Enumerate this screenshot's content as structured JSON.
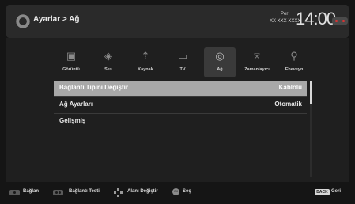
{
  "header": {
    "breadcrumb": "Ayarlar > Ağ",
    "day": "Per",
    "date": "XX XXX XXXX",
    "time": "14:00"
  },
  "tabs": [
    {
      "label": "Görüntü",
      "icon": "picture-icon"
    },
    {
      "label": "Ses",
      "icon": "speaker-icon"
    },
    {
      "label": "Kaynak",
      "icon": "source-icon"
    },
    {
      "label": "TV",
      "icon": "tv-icon"
    },
    {
      "label": "Ağ",
      "icon": "network-globe-icon",
      "active": true
    },
    {
      "label": "Zamanlayıcı",
      "icon": "timer-icon"
    },
    {
      "label": "Ebeveyn",
      "icon": "parental-icon"
    }
  ],
  "menu": [
    {
      "label": "Bağlantı Tipini Değiştir",
      "value": "Kablolu",
      "selected": true
    },
    {
      "label": "Ağ Ayarları",
      "value": "Otomatik"
    },
    {
      "label": "Gelişmiş",
      "value": ""
    }
  ],
  "footer": {
    "connect": "Bağlan",
    "test": "Bağlantı Testi",
    "move": "Alanı Değiştir",
    "select": "Seç",
    "back_key": "BACK",
    "back": "Geri"
  },
  "colors": {
    "selected_row": "#a8a8a8",
    "background": "#151515",
    "accent_dot": "#dd3333"
  }
}
